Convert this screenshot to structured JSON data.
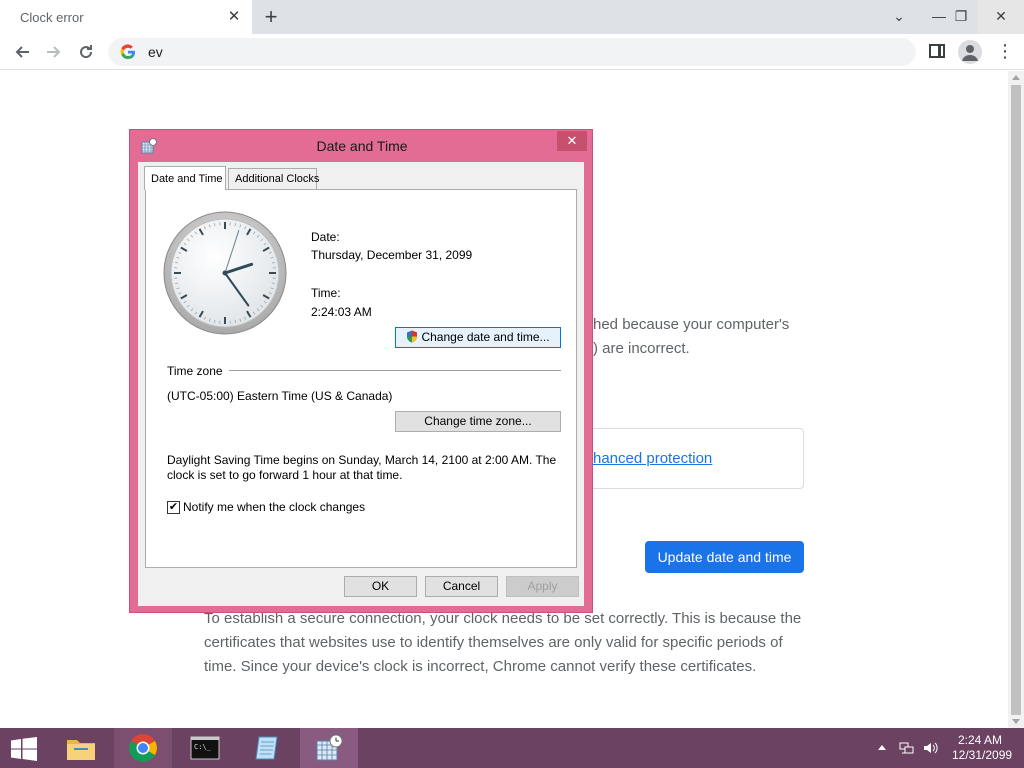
{
  "browser": {
    "tab_title": "Clock error",
    "tab_close_glyph": "✕",
    "new_tab_glyph": "+",
    "omnibox_text": "ev",
    "icons": {
      "back": "arrow-left-icon",
      "forward": "arrow-right-icon",
      "reload": "reload-icon",
      "search_engine": "google-g-icon",
      "side_panel": "side-panel-icon",
      "profile": "profile-icon",
      "menu": "menu-dots-icon"
    },
    "window_controls": {
      "dropdown": "⌄",
      "minimize": "—",
      "restore": "❐",
      "close": "✕"
    }
  },
  "page": {
    "body_line1": "hed because your computer's",
    "body_line2": ") are incorrect.",
    "protection_link": "hanced protection",
    "update_button": "Update date and time",
    "detail_text": "To establish a secure connection, your clock needs to be set correctly. This is because the certificates that websites use to identify themselves are only valid for specific periods of time. Since your device's clock is incorrect, Chrome cannot verify these certificates."
  },
  "dialog": {
    "title": "Date and Time",
    "close_glyph": "✕",
    "tabs": [
      {
        "label": "Date and Time",
        "active": true
      },
      {
        "label": "Additional Clocks",
        "active": false
      }
    ],
    "date_label": "Date:",
    "date_value": "Thursday, December 31, 2099",
    "time_label": "Time:",
    "time_value": "2:24:03 AM",
    "change_datetime_button": "Change date and time...",
    "timezone_heading": "Time zone",
    "timezone_value": "(UTC-05:00) Eastern Time (US & Canada)",
    "change_timezone_button": "Change time zone...",
    "dst_line1": "Daylight Saving Time begins on Sunday, March 14, 2100 at 2:00 AM. The",
    "dst_line2": "clock is set to go forward 1 hour at that time.",
    "notify_checkbox_label": "Notify me when the clock changes",
    "notify_checked": true,
    "ok_button": "OK",
    "cancel_button": "Cancel",
    "apply_button": "Apply",
    "clock": {
      "hour": 2,
      "minute": 24,
      "second": 3
    }
  },
  "taskbar": {
    "apps": [
      {
        "name": "file-explorer-icon",
        "state": "normal"
      },
      {
        "name": "chrome-icon",
        "state": "open"
      },
      {
        "name": "command-prompt-icon",
        "state": "normal"
      },
      {
        "name": "notepad-icon",
        "state": "normal"
      },
      {
        "name": "date-time-control-panel-icon",
        "state": "active"
      }
    ],
    "tray_time": "2:24 AM",
    "tray_date": "12/31/2099"
  },
  "colors": {
    "dialog_frame": "#e26c94",
    "taskbar": "#6b4262",
    "accent_blue": "#1a73e8"
  }
}
